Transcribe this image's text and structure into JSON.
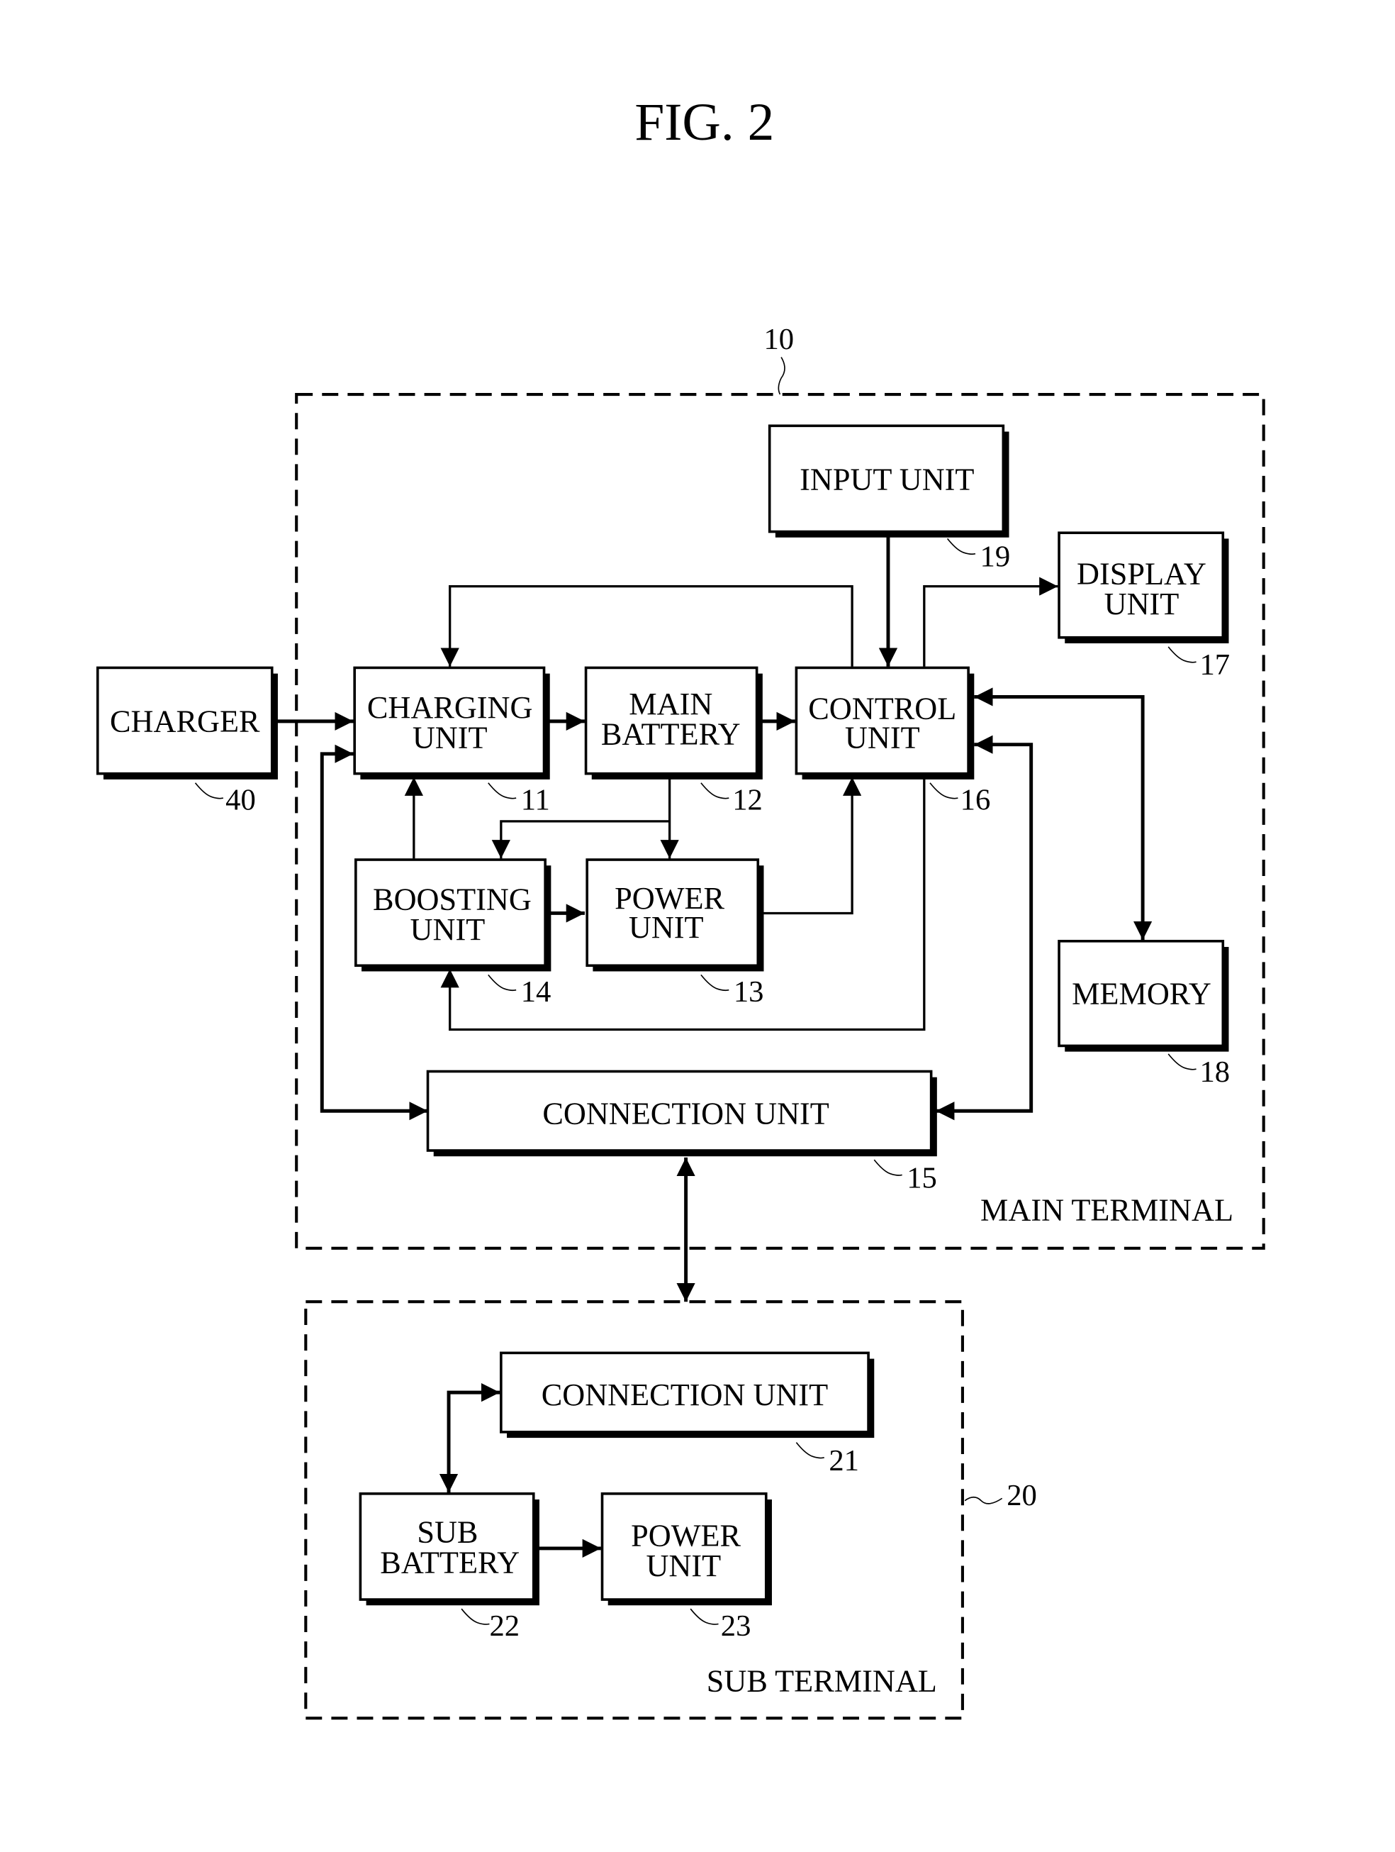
{
  "figure": {
    "title": "FIG. 2"
  },
  "main_terminal": {
    "ref": "10",
    "label": "MAIN TERMINAL",
    "blocks": {
      "input_unit": {
        "lines": [
          "INPUT UNIT"
        ],
        "ref": "19"
      },
      "display_unit": {
        "lines": [
          "DISPLAY",
          "UNIT"
        ],
        "ref": "17"
      },
      "charging_unit": {
        "lines": [
          "CHARGING",
          "UNIT"
        ],
        "ref": "11"
      },
      "main_battery": {
        "lines": [
          "MAIN",
          "BATTERY"
        ],
        "ref": "12"
      },
      "control_unit": {
        "lines": [
          "CONTROL",
          "UNIT"
        ],
        "ref": "16"
      },
      "boosting_unit": {
        "lines": [
          "BOOSTING",
          "UNIT"
        ],
        "ref": "14"
      },
      "power_unit": {
        "lines": [
          "POWER",
          "UNIT"
        ],
        "ref": "13"
      },
      "memory": {
        "lines": [
          "MEMORY"
        ],
        "ref": "18"
      },
      "connection_unit": {
        "lines": [
          "CONNECTION UNIT"
        ],
        "ref": "15"
      }
    }
  },
  "charger": {
    "lines": [
      "CHARGER"
    ],
    "ref": "40"
  },
  "sub_terminal": {
    "ref": "20",
    "label": "SUB TERMINAL",
    "blocks": {
      "connection_unit": {
        "lines": [
          "CONNECTION UNIT"
        ],
        "ref": "21"
      },
      "sub_battery": {
        "lines": [
          "SUB",
          "BATTERY"
        ],
        "ref": "22"
      },
      "power_unit": {
        "lines": [
          "POWER",
          "UNIT"
        ],
        "ref": "23"
      }
    }
  },
  "connections": [
    {
      "from": "charger",
      "to": "charging_unit",
      "direction": "one-way"
    },
    {
      "from": "charging_unit",
      "to": "main_battery",
      "direction": "one-way"
    },
    {
      "from": "main_battery",
      "to": "control_unit",
      "direction": "one-way"
    },
    {
      "from": "input_unit",
      "to": "control_unit",
      "direction": "one-way"
    },
    {
      "from": "control_unit",
      "to": "display_unit",
      "direction": "one-way"
    },
    {
      "from": "control_unit",
      "to": "charging_unit",
      "direction": "one-way"
    },
    {
      "from": "control_unit",
      "to": "memory",
      "direction": "two-way"
    },
    {
      "from": "main_battery",
      "to": "boosting_unit",
      "direction": "one-way"
    },
    {
      "from": "main_battery",
      "to": "power_unit",
      "direction": "one-way"
    },
    {
      "from": "boosting_unit",
      "to": "charging_unit",
      "direction": "one-way"
    },
    {
      "from": "boosting_unit",
      "to": "power_unit",
      "direction": "one-way"
    },
    {
      "from": "power_unit",
      "to": "control_unit",
      "direction": "one-way"
    },
    {
      "from": "control_unit",
      "to": "boosting_unit",
      "direction": "one-way"
    },
    {
      "from": "control_unit",
      "to": "connection_unit",
      "direction": "two-way"
    },
    {
      "from": "charging_unit",
      "to": "connection_unit",
      "direction": "two-way"
    },
    {
      "from": "main_connection_unit",
      "to": "sub_connection_unit",
      "direction": "two-way"
    },
    {
      "from": "sub_connection_unit",
      "to": "sub_battery",
      "direction": "two-way"
    },
    {
      "from": "sub_battery",
      "to": "sub_power_unit",
      "direction": "one-way"
    }
  ]
}
